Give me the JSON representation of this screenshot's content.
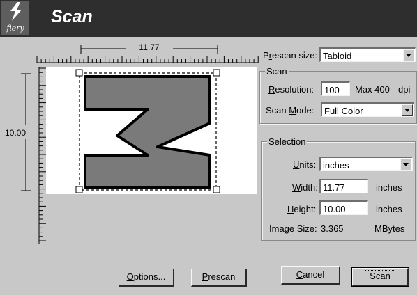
{
  "header": {
    "logo_text": "fiery",
    "title": "Scan"
  },
  "rulers": {
    "width_label": "11.77",
    "height_label": "10.00"
  },
  "prescan": {
    "label_pre": "P",
    "label_u": "r",
    "label_post": "escan size:",
    "value": "Tabloid"
  },
  "scan_group": {
    "title": "Scan",
    "resolution": {
      "label_u": "R",
      "label_post": "esolution:",
      "value": "100",
      "max": "Max 400",
      "unit": "dpi"
    },
    "scan_mode": {
      "label_pre": "Scan ",
      "label_u": "M",
      "label_post": "ode:",
      "value": "Full Color"
    }
  },
  "selection": {
    "title": "Selection",
    "units": {
      "label_u": "U",
      "label_post": "nits:",
      "value": "inches"
    },
    "width": {
      "label_u": "W",
      "label_post": "idth:",
      "value": "11.77",
      "unit": "inches"
    },
    "height": {
      "label_u": "H",
      "label_post": "eight:",
      "value": "10.00",
      "unit": "inches"
    },
    "image_size": {
      "label": "Image Size:",
      "value": "3.365",
      "unit": "MBytes"
    }
  },
  "buttons": {
    "options": {
      "u": "O",
      "rest": "ptions..."
    },
    "prescan": {
      "u": "P",
      "rest": "rescan"
    },
    "cancel": {
      "u": "C",
      "rest": "ancel"
    },
    "scan": {
      "u": "S",
      "rest": "can"
    }
  },
  "colors": {
    "titlebar": "#2e2e2e",
    "window": "#c8c8c8",
    "shape_fill": "#7a7a7a"
  }
}
